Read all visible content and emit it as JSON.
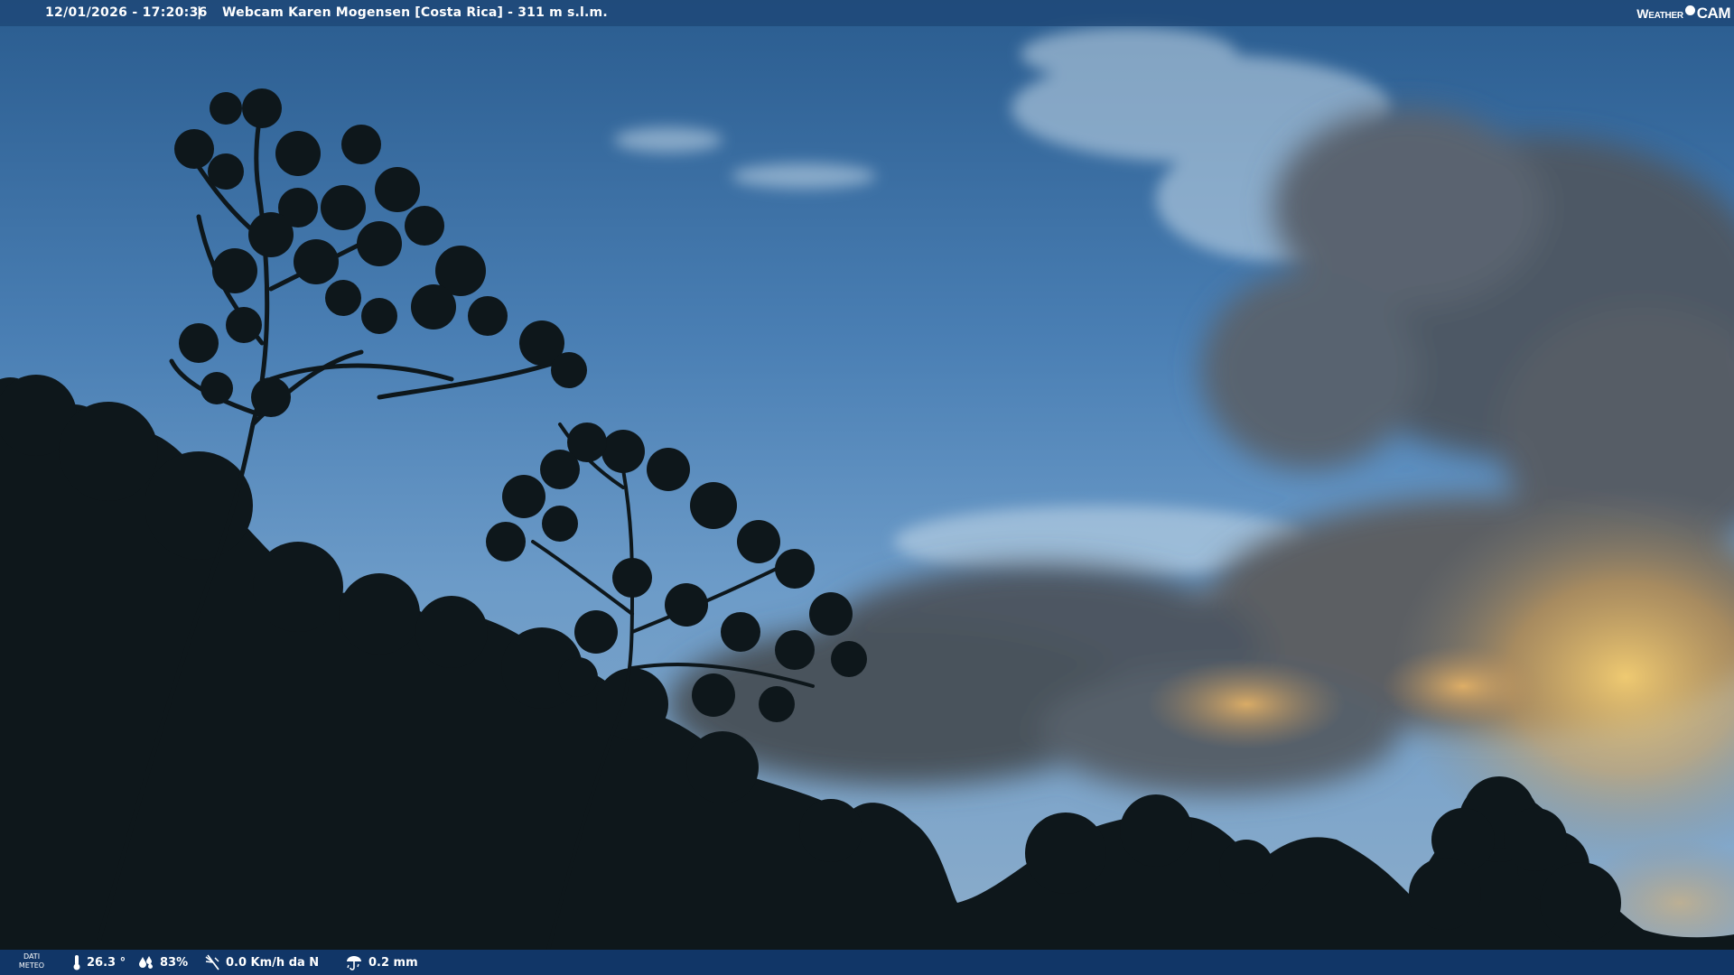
{
  "header": {
    "datetime": "12/01/2026 - 17:20:36",
    "separator": "|",
    "title": "Webcam Karen Mogensen [Costa Rica]  - 311 m s.l.m.",
    "logo": {
      "weather": "Weather",
      "cam": "CAM"
    }
  },
  "footer": {
    "dati_line1": "DATI",
    "dati_line2": "METEO",
    "temperature": "26.3 °",
    "humidity": "83%",
    "wind": "0.0 Km/h da N",
    "rain": "0.2 mm",
    "icons": [
      "thermometer-icon",
      "humidity-drops-icon",
      "wind-icon",
      "rain-gauge-icon"
    ]
  },
  "colors": {
    "bar": "#1e4676",
    "sky_top": "#2a5d90",
    "sky_mid": "#5f92c4",
    "sunset_glow": "#f2c46a",
    "silhouette": "#0c1418"
  }
}
